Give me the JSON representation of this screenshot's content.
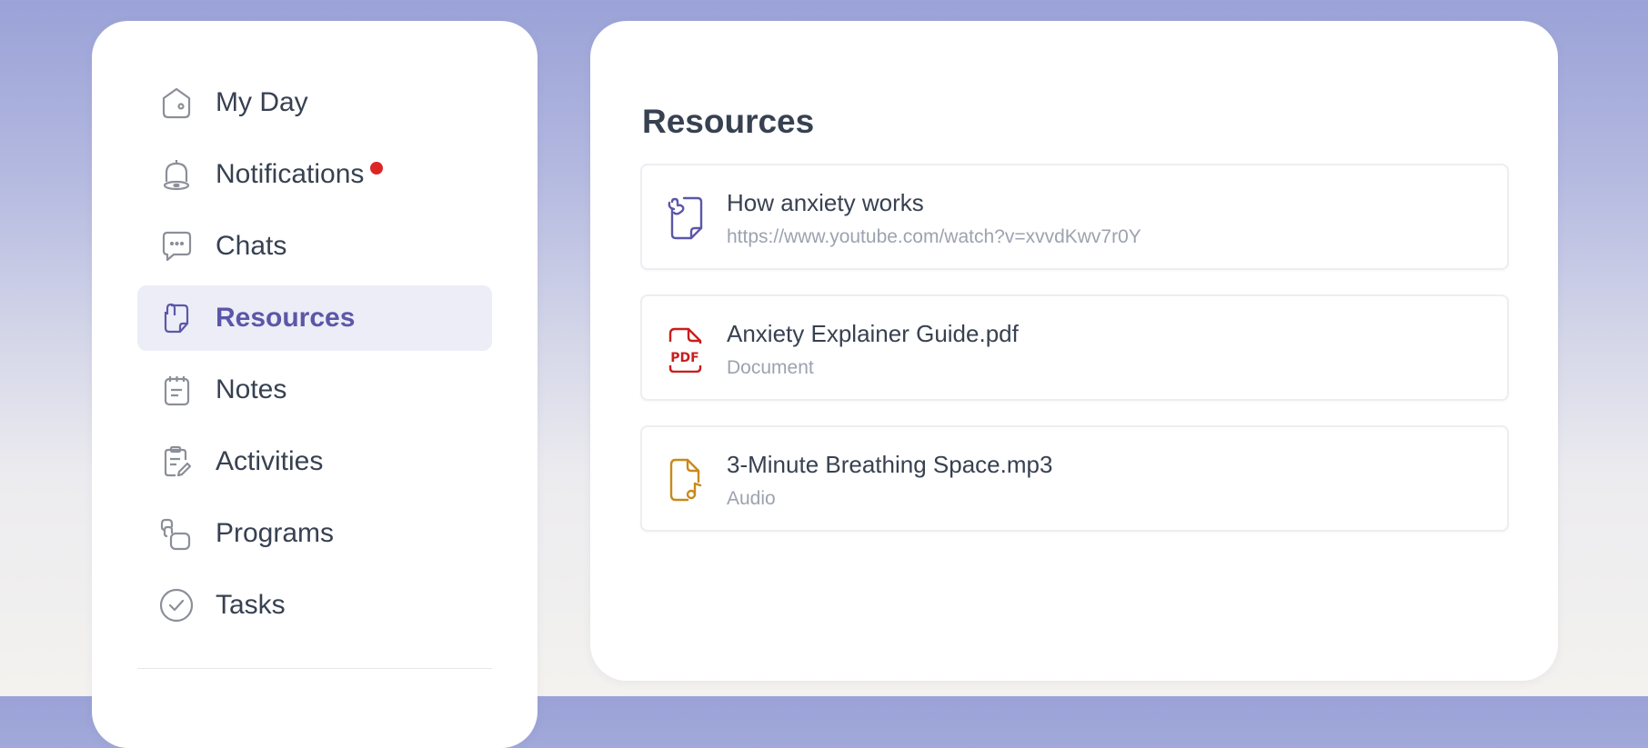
{
  "sidebar": {
    "items": [
      {
        "label": "My Day",
        "icon": "home-icon"
      },
      {
        "label": "Notifications",
        "icon": "bell-icon"
      },
      {
        "label": "Chats",
        "icon": "chat-icon"
      },
      {
        "label": "Resources",
        "icon": "resource-icon"
      },
      {
        "label": "Notes",
        "icon": "notepad-icon"
      },
      {
        "label": "Activities",
        "icon": "clipboard-edit-icon"
      },
      {
        "label": "Programs",
        "icon": "programs-icon"
      },
      {
        "label": "Tasks",
        "icon": "check-circle-icon"
      }
    ],
    "active_item": "Resources"
  },
  "main": {
    "title": "Resources",
    "resources": [
      {
        "title": "How anxiety works",
        "subtitle": "https://www.youtube.com/watch?v=xvvdKwv7r0Y",
        "icon": "link-file-icon",
        "color": "#5b57a8"
      },
      {
        "title": "Anxiety Explainer Guide.pdf",
        "subtitle": "Document",
        "icon": "pdf-file-icon",
        "color": "#c81e1e"
      },
      {
        "title": "3-Minute Breathing Space.mp3",
        "subtitle": "Audio",
        "icon": "audio-file-icon",
        "color": "#c88a1a"
      }
    ]
  },
  "colors": {
    "accent": "#5b57a8",
    "active_bg": "#ecedf7",
    "notification_badge": "#dc2626"
  }
}
